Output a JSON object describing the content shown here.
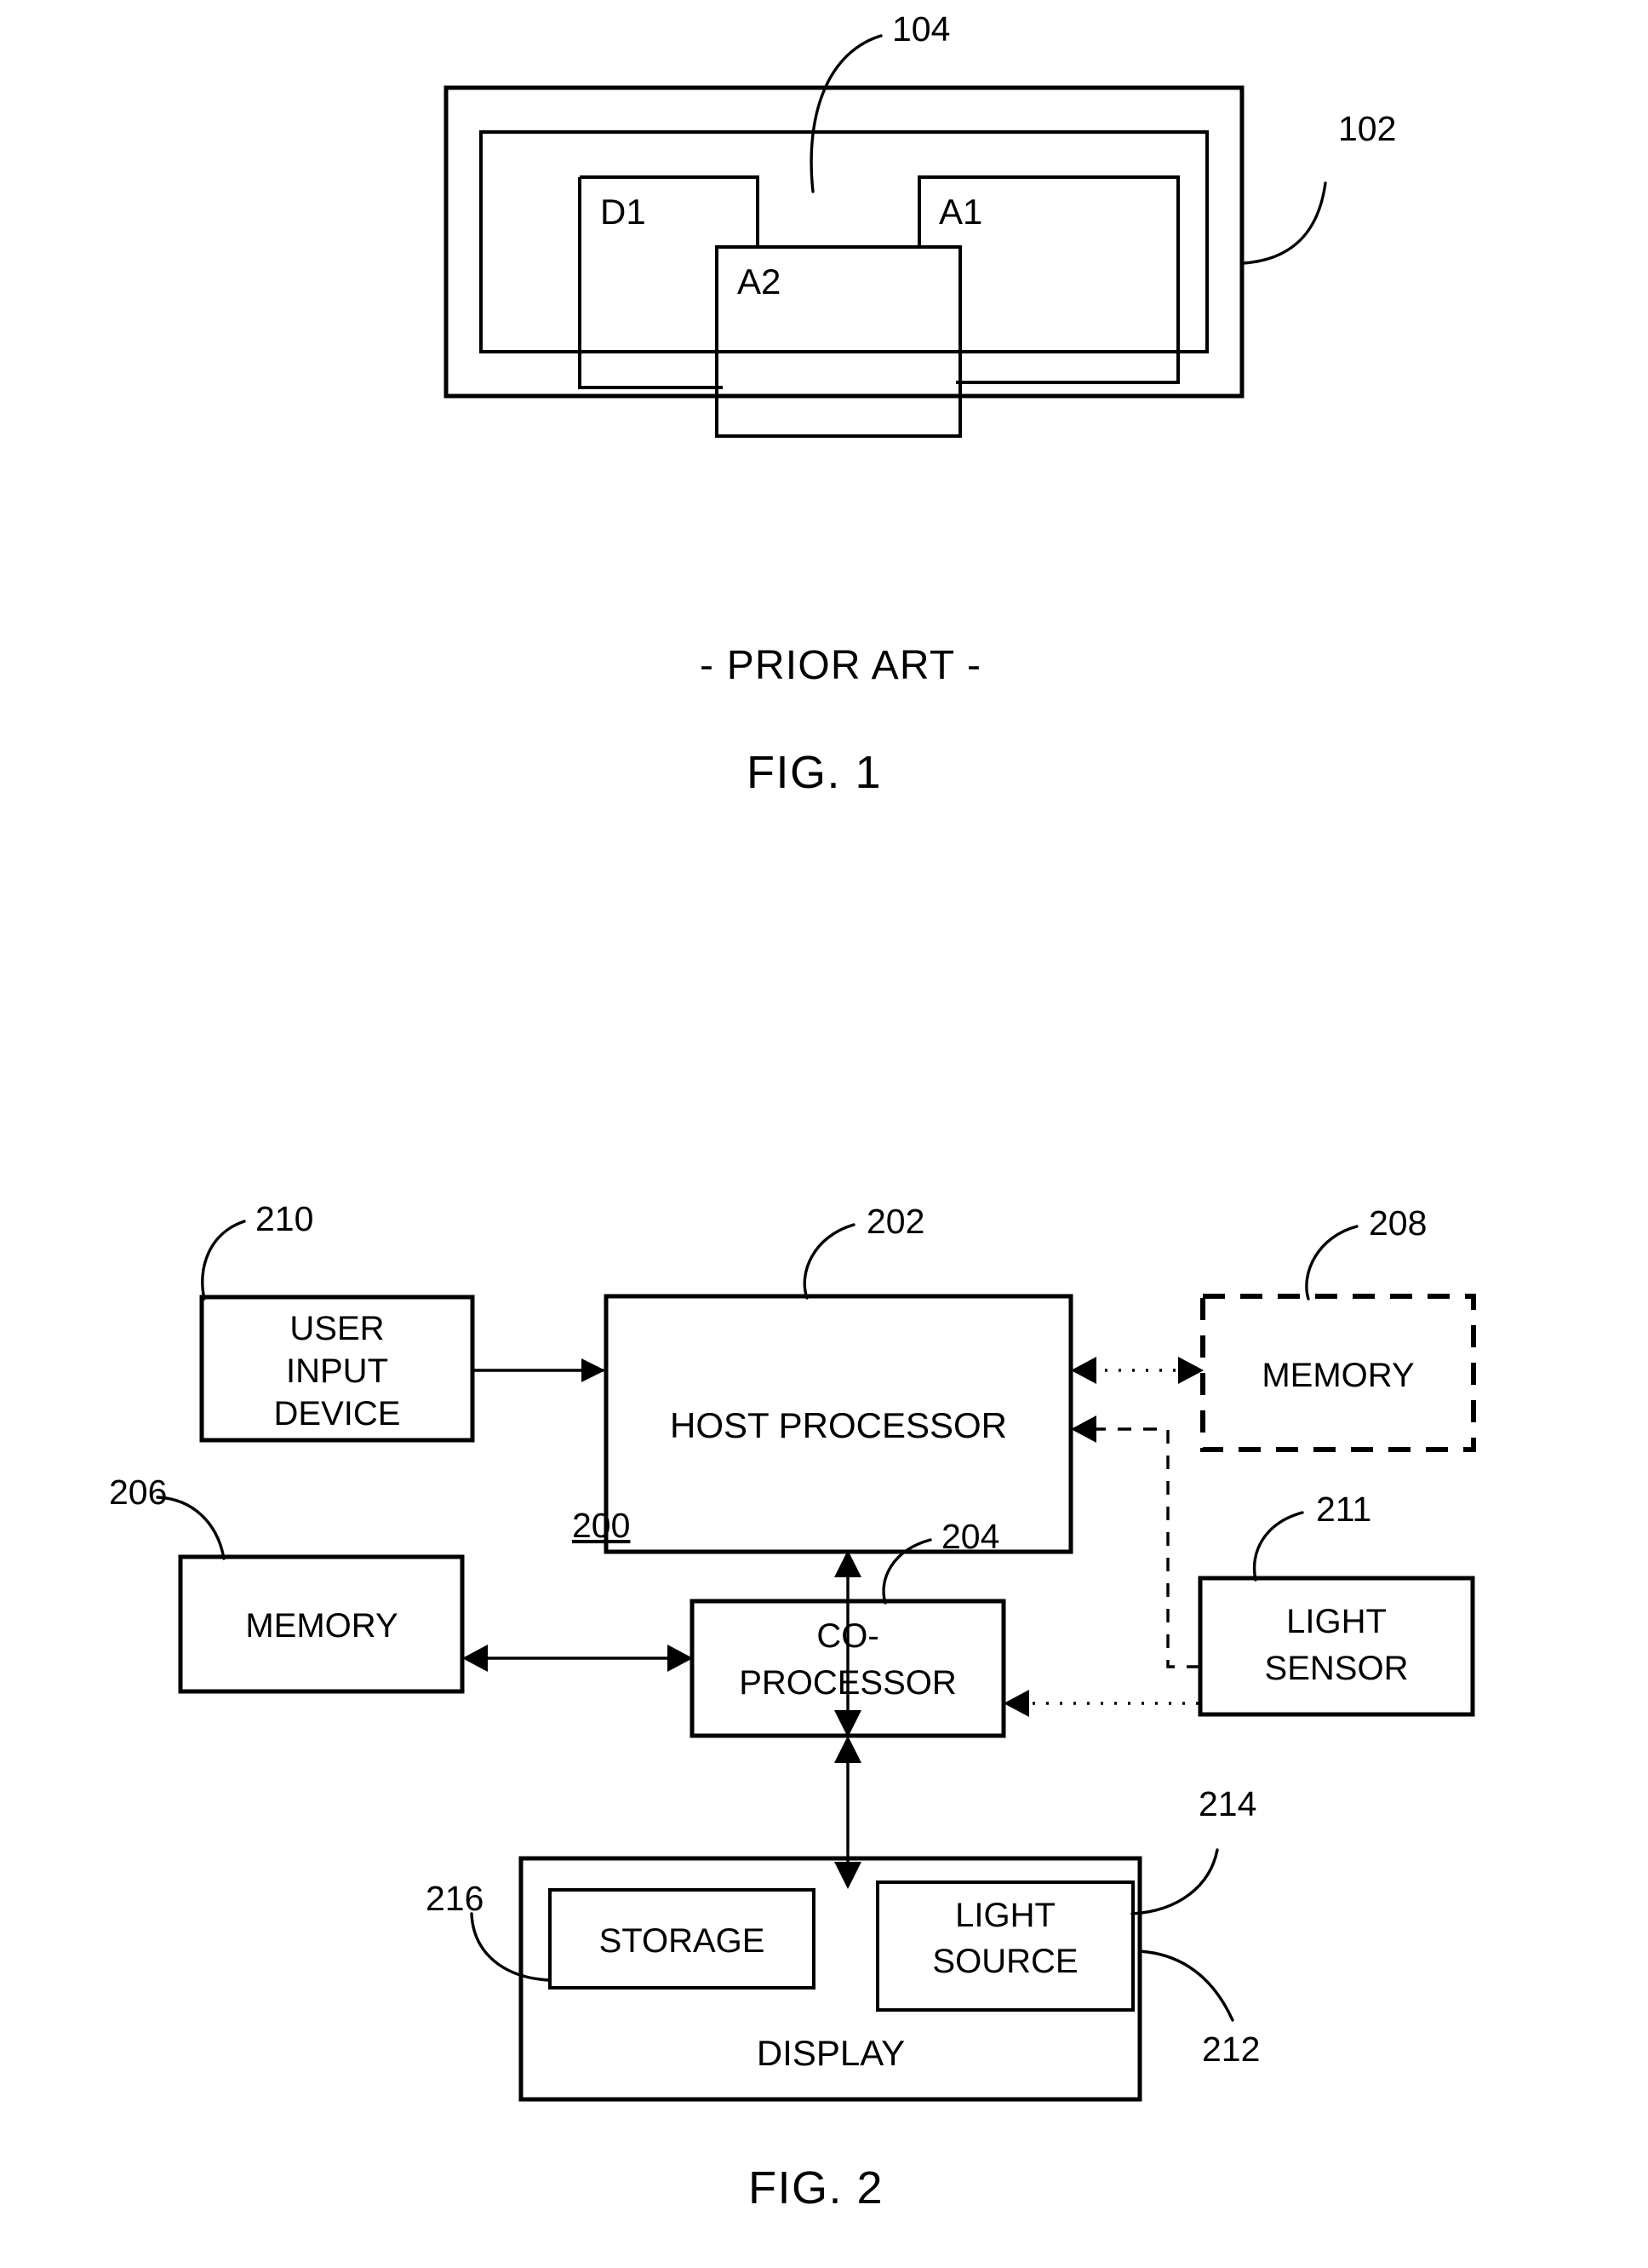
{
  "document": {
    "type": "patent-drawing-sheet",
    "figures": [
      "FIG. 1",
      "FIG. 2"
    ]
  },
  "figure1": {
    "caption": "FIG. 1",
    "subcaption": "- PRIOR ART -",
    "reference_numerals": {
      "outer_frame": "102",
      "inner_frame": "104"
    },
    "windows": [
      {
        "label": "D1",
        "name": "window-d1"
      },
      {
        "label": "A1",
        "name": "window-a1"
      },
      {
        "label": "A2",
        "name": "window-a2"
      }
    ]
  },
  "figure2": {
    "caption": "FIG. 2",
    "system_numeral": "200",
    "blocks": [
      {
        "id": "user-input-device",
        "numeral": "210",
        "lines": [
          "USER",
          "INPUT",
          "DEVICE"
        ],
        "border": "solid"
      },
      {
        "id": "host-processor",
        "numeral": "202",
        "lines": [
          "HOST PROCESSOR"
        ],
        "border": "solid"
      },
      {
        "id": "memory-208",
        "numeral": "208",
        "lines": [
          "MEMORY"
        ],
        "border": "dashed"
      },
      {
        "id": "memory-206",
        "numeral": "206",
        "lines": [
          "MEMORY"
        ],
        "border": "solid"
      },
      {
        "id": "co-processor",
        "numeral": "204",
        "lines": [
          "CO-",
          "PROCESSOR"
        ],
        "border": "solid"
      },
      {
        "id": "light-sensor",
        "numeral": "211",
        "lines": [
          "LIGHT",
          "SENSOR"
        ],
        "border": "solid"
      },
      {
        "id": "display",
        "numeral": "212",
        "lines": [
          "DISPLAY"
        ],
        "border": "solid"
      },
      {
        "id": "storage",
        "numeral": "216",
        "lines": [
          "STORAGE"
        ],
        "border": "solid"
      },
      {
        "id": "light-source",
        "numeral": "214",
        "lines": [
          "LIGHT",
          "SOURCE"
        ],
        "border": "solid"
      }
    ],
    "connections": [
      {
        "from": "user-input-device",
        "to": "host-processor",
        "style": "solid",
        "arrows": "single"
      },
      {
        "from": "host-processor",
        "to": "memory-208",
        "style": "dotted",
        "arrows": "double"
      },
      {
        "from": "light-sensor",
        "to": "host-processor",
        "style": "dashed",
        "arrows": "single"
      },
      {
        "from": "host-processor",
        "to": "co-processor",
        "style": "solid",
        "arrows": "double"
      },
      {
        "from": "memory-206",
        "to": "co-processor",
        "style": "solid",
        "arrows": "double"
      },
      {
        "from": "light-sensor",
        "to": "co-processor",
        "style": "dotted",
        "arrows": "single"
      },
      {
        "from": "co-processor",
        "to": "display",
        "style": "solid",
        "arrows": "double"
      }
    ]
  },
  "labels": {
    "n102": "102",
    "n104": "104",
    "n200": "200",
    "n202": "202",
    "n204": "204",
    "n206": "206",
    "n208": "208",
    "n210": "210",
    "n211": "211",
    "n212": "212",
    "n214": "214",
    "n216": "216",
    "d1": "D1",
    "a1": "A1",
    "a2": "A2",
    "prior_art": "- PRIOR ART -",
    "fig1": "FIG. 1",
    "fig2": "FIG. 2",
    "user_input_l1": "USER",
    "user_input_l2": "INPUT",
    "user_input_l3": "DEVICE",
    "host_processor": "HOST PROCESSOR",
    "memory208": "MEMORY",
    "memory206": "MEMORY",
    "coproc_l1": "CO-",
    "coproc_l2": "PROCESSOR",
    "light_sensor_l1": "LIGHT",
    "light_sensor_l2": "SENSOR",
    "storage": "STORAGE",
    "light_source_l1": "LIGHT",
    "light_source_l2": "SOURCE",
    "display": "DISPLAY"
  },
  "colors": {
    "ink": "#000000",
    "paper": "#ffffff"
  }
}
